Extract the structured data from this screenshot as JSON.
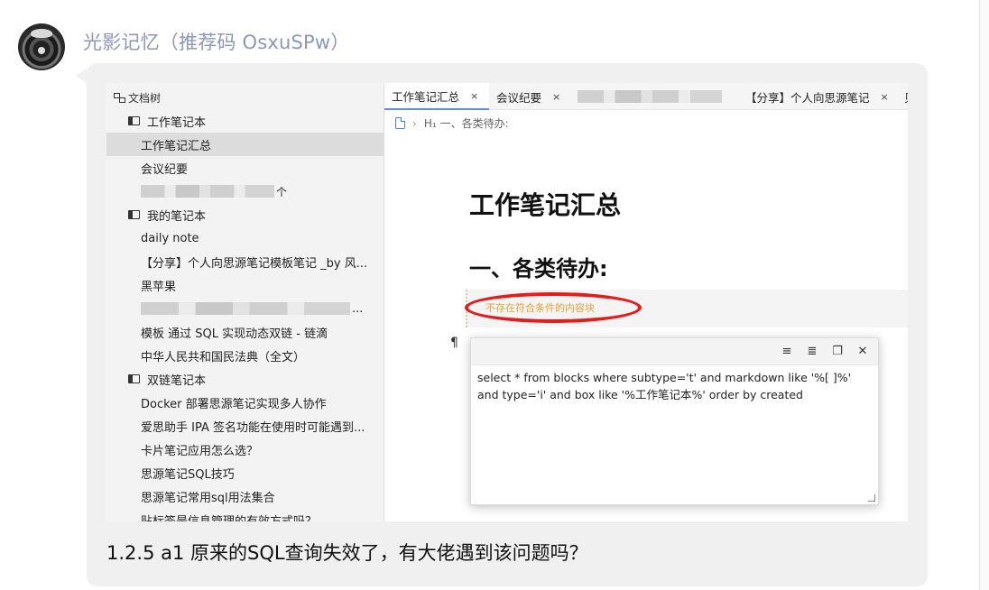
{
  "post": {
    "username": "光影记忆（推荐码 OsxuSPw）",
    "caption": "1.2.5 a1 原来的SQL查询失效了，有大佬遇到该问题吗？"
  },
  "sidebar": {
    "header": "文档树",
    "items": [
      {
        "kind": "notebook",
        "label": "工作笔记本"
      },
      {
        "kind": "doc",
        "label": "工作笔记汇总",
        "selected": true
      },
      {
        "kind": "doc",
        "label": "会议纪要"
      },
      {
        "kind": "doc",
        "label": "个",
        "blurred": true
      },
      {
        "kind": "notebook",
        "label": "我的笔记本"
      },
      {
        "kind": "doc",
        "label": "daily note"
      },
      {
        "kind": "doc",
        "label": "【分享】个人向思源笔记模板笔记 _by 风..."
      },
      {
        "kind": "doc",
        "label": "黑苹果"
      },
      {
        "kind": "doc",
        "label": "...",
        "blurred": true
      },
      {
        "kind": "doc",
        "label": "模板 通过 SQL 实现动态双链 - 链滴"
      },
      {
        "kind": "doc",
        "label": "中华人民共和国民法典（全文）"
      },
      {
        "kind": "notebook",
        "label": "双链笔记本"
      },
      {
        "kind": "doc",
        "label": "Docker 部署思源笔记实现多人协作"
      },
      {
        "kind": "doc",
        "label": "爱思助手 IPA 签名功能在使用时可能遇到..."
      },
      {
        "kind": "doc",
        "label": "卡片笔记应用怎么选？"
      },
      {
        "kind": "doc",
        "label": "思源笔记SQL技巧"
      },
      {
        "kind": "doc",
        "label": "思源笔记常用sql用法集合"
      },
      {
        "kind": "doc",
        "label": "贴标签是信息管理的有效方式吗？"
      }
    ]
  },
  "tabs": [
    {
      "label": "工作笔记汇总",
      "close": "×",
      "active": true
    },
    {
      "label": "会议纪要",
      "close": "×"
    },
    {
      "label": "",
      "blurred": true
    },
    {
      "label": "【分享】个人向思源笔记",
      "close": "×"
    },
    {
      "label": "贝"
    }
  ],
  "breadcrumb": {
    "heading_marker": "H₁",
    "text": "一、各类待办:"
  },
  "document": {
    "title": "工作笔记汇总",
    "heading": "一、各类待办:",
    "embed_empty_text": "不存在符合条件的内容块",
    "pilcrow": "¶"
  },
  "sql_panel": {
    "query": "select * from blocks where subtype='t' and markdown like '%[ ]%' and type='i' and box  like '%工作笔记本%' order by created",
    "icons": [
      "align-left-icon",
      "align-right-icon",
      "copy-icon",
      "close-icon"
    ]
  },
  "colors": {
    "username": "#8d97b8",
    "embed_text": "#e2a23a",
    "annotation": "#e31c1c",
    "tab_accent": "#5b8def"
  }
}
